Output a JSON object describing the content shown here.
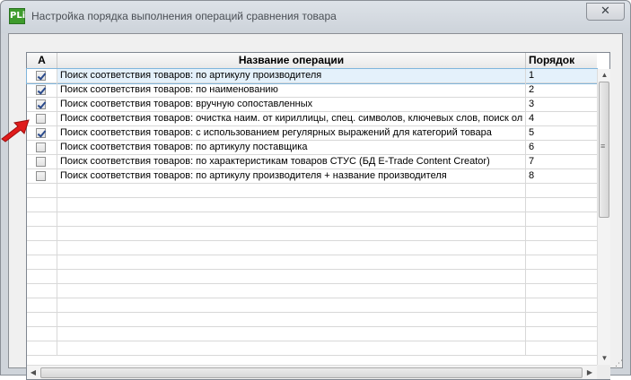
{
  "window": {
    "title": "Настройка порядка выполнения операций сравнения товара",
    "app_icon_text": "PLi",
    "close_symbol": "✕"
  },
  "grid": {
    "headers": {
      "a": "A",
      "name": "Название операции",
      "order": "Порядок"
    },
    "rows": [
      {
        "checked": true,
        "name": "Поиск соответствия товаров: по артикулу производителя",
        "order": "1",
        "selected": true
      },
      {
        "checked": true,
        "name": "Поиск соответствия товаров: по наименованию",
        "order": "2"
      },
      {
        "checked": true,
        "name": "Поиск соответствия товаров: вручную сопоставленных",
        "order": "3"
      },
      {
        "checked": false,
        "name": "Поиск соответствия товаров: очистка наим. от кириллицы, спец. символов, ключевых слов, поиск ол",
        "order": "4"
      },
      {
        "checked": true,
        "name": "Поиск соответствия товаров: с использованием регулярных выражений для категорий товара",
        "order": "5"
      },
      {
        "checked": false,
        "name": "Поиск соответствия товаров: по артикулу поставщика",
        "order": "6"
      },
      {
        "checked": false,
        "name": "Поиск соответствия товаров: по характеристикам товаров СТУС (БД E-Trade Content Creator)",
        "order": "7"
      },
      {
        "checked": false,
        "name": "Поиск соответствия товаров: по артикулу производителя + название производителя",
        "order": "8"
      }
    ],
    "empty_rows": 12
  },
  "icons": {
    "scroll_up": "▲",
    "scroll_down": "▼",
    "scroll_left": "◀",
    "scroll_right": "▶",
    "thumb_grip": "≡",
    "resize_grip": "⋰"
  },
  "colors": {
    "accent_arrow": "#e01b1b",
    "selection": "#e4f1fb",
    "app_icon": "#3e9b2c"
  }
}
